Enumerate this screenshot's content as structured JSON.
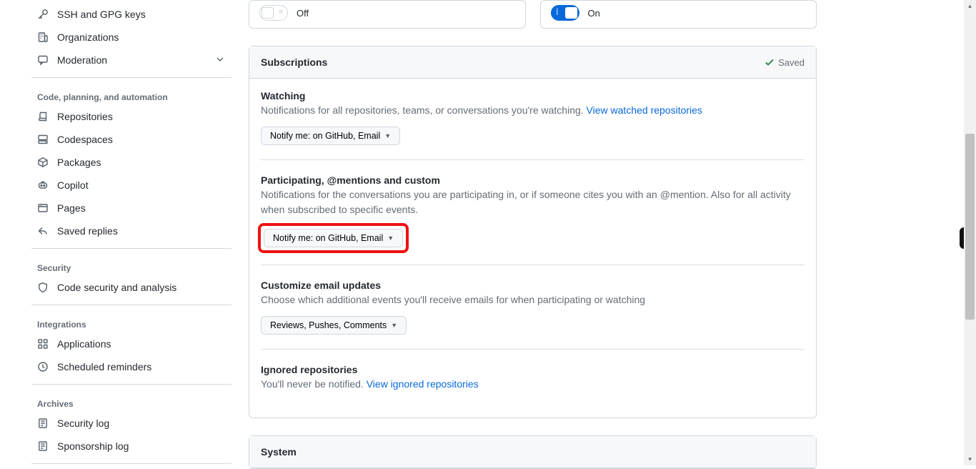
{
  "sidebar": {
    "items_top": [
      {
        "label": "SSH and GPG keys"
      },
      {
        "label": "Organizations"
      },
      {
        "label": "Moderation"
      }
    ],
    "group_code": {
      "label": "Code, planning, and automation",
      "items": [
        {
          "label": "Repositories"
        },
        {
          "label": "Codespaces"
        },
        {
          "label": "Packages"
        },
        {
          "label": "Copilot"
        },
        {
          "label": "Pages"
        },
        {
          "label": "Saved replies"
        }
      ]
    },
    "group_security": {
      "label": "Security",
      "items": [
        {
          "label": "Code security and analysis"
        }
      ]
    },
    "group_integrations": {
      "label": "Integrations",
      "items": [
        {
          "label": "Applications"
        },
        {
          "label": "Scheduled reminders"
        }
      ]
    },
    "group_archives": {
      "label": "Archives",
      "items": [
        {
          "label": "Security log"
        },
        {
          "label": "Sponsorship log"
        }
      ]
    }
  },
  "toggles": {
    "off_label": "Off",
    "on_label": "On"
  },
  "subscriptions": {
    "title": "Subscriptions",
    "saved_label": "Saved",
    "watching": {
      "title": "Watching",
      "desc": "Notifications for all repositories, teams, or conversations you're watching. ",
      "link": "View watched repositories",
      "btn": "Notify me: on GitHub, Email"
    },
    "participating": {
      "title": "Participating, @mentions and custom",
      "desc": "Notifications for the conversations you are participating in, or if someone cites you with an @mention. Also for all activity when subscribed to specific events.",
      "btn": "Notify me: on GitHub, Email"
    },
    "customize": {
      "title": "Customize email updates",
      "desc": "Choose which additional events you'll receive emails for when participating or watching",
      "btn": "Reviews, Pushes, Comments"
    },
    "ignored": {
      "title": "Ignored repositories",
      "desc": "You'll never be notified. ",
      "link": "View ignored repositories"
    }
  },
  "system": {
    "title": "System"
  }
}
